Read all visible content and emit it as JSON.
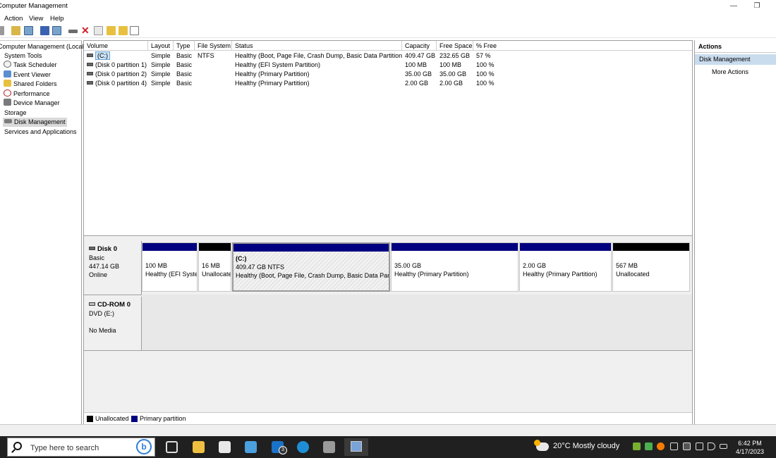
{
  "window": {
    "title": "Computer Management",
    "min_label": "—",
    "restore_label": "❐"
  },
  "menu": [
    "Action",
    "View",
    "Help"
  ],
  "tree": [
    {
      "label": "Computer Management (Local)",
      "icon": "computer-icon"
    },
    {
      "label": "System Tools",
      "icon": "tools-icon"
    },
    {
      "label": "Task Scheduler",
      "icon": "clock-icon"
    },
    {
      "label": "Event Viewer",
      "icon": "event-viewer-icon"
    },
    {
      "label": "Shared Folders",
      "icon": "shared-folder-icon"
    },
    {
      "label": "Performance",
      "icon": "performance-icon"
    },
    {
      "label": "Device Manager",
      "icon": "device-manager-icon"
    },
    {
      "label": "Storage",
      "icon": "storage-icon"
    },
    {
      "label": "Disk Management",
      "icon": "disk-icon"
    },
    {
      "label": "Services and Applications",
      "icon": "services-icon"
    }
  ],
  "volume_table": {
    "headers": [
      "Volume",
      "Layout",
      "Type",
      "File System",
      "Status",
      "Capacity",
      "Free Space",
      "% Free"
    ],
    "rows": [
      [
        "(C:)",
        "Simple",
        "Basic",
        "NTFS",
        "Healthy (Boot, Page File, Crash Dump, Basic Data Partition)",
        "409.47 GB",
        "232.65 GB",
        "57 %"
      ],
      [
        "(Disk 0 partition 1)",
        "Simple",
        "Basic",
        "",
        "Healthy (EFI System Partition)",
        "100 MB",
        "100 MB",
        "100 %"
      ],
      [
        "(Disk 0 partition 2)",
        "Simple",
        "Basic",
        "",
        "Healthy (Primary Partition)",
        "35.00 GB",
        "35.00 GB",
        "100 %"
      ],
      [
        "(Disk 0 partition 4)",
        "Simple",
        "Basic",
        "",
        "Healthy (Primary Partition)",
        "2.00 GB",
        "2.00 GB",
        "100 %"
      ]
    ]
  },
  "disk0": {
    "name": "Disk 0",
    "type": "Basic",
    "size": "447.14 GB",
    "state": "Online",
    "partitions": [
      {
        "title": "",
        "line1": "100 MB",
        "line2": "Healthy (EFI System Partition)",
        "kind": "primary"
      },
      {
        "title": "",
        "line1": "16 MB",
        "line2": "Unallocated",
        "kind": "unallocated"
      },
      {
        "title": "(C:)",
        "line1": "409.47 GB NTFS",
        "line2": "Healthy (Boot, Page File, Crash Dump, Basic Data Partition)",
        "kind": "primary"
      },
      {
        "title": "",
        "line1": "35.00 GB",
        "line2": "Healthy (Primary Partition)",
        "kind": "primary"
      },
      {
        "title": "",
        "line1": "2.00 GB",
        "line2": "Healthy (Primary Partition)",
        "kind": "primary"
      },
      {
        "title": "",
        "line1": "567 MB",
        "line2": "Unallocated",
        "kind": "unallocated"
      }
    ]
  },
  "cdrom": {
    "name": "CD-ROM 0",
    "drive": "DVD (E:)",
    "media": "No Media"
  },
  "legend": {
    "unallocated": "Unallocated",
    "primary": "Primary partition"
  },
  "colors": {
    "primary": "#000080",
    "unallocated": "#000000"
  },
  "actions": {
    "header": "Actions",
    "section": "Disk Management",
    "more": "More Actions"
  },
  "taskbar": {
    "search_placeholder": "Type here to search",
    "mail_badge": "3",
    "weather": "20°C  Mostly cloudy",
    "time": "6:42 PM",
    "date": "4/17/2023"
  }
}
